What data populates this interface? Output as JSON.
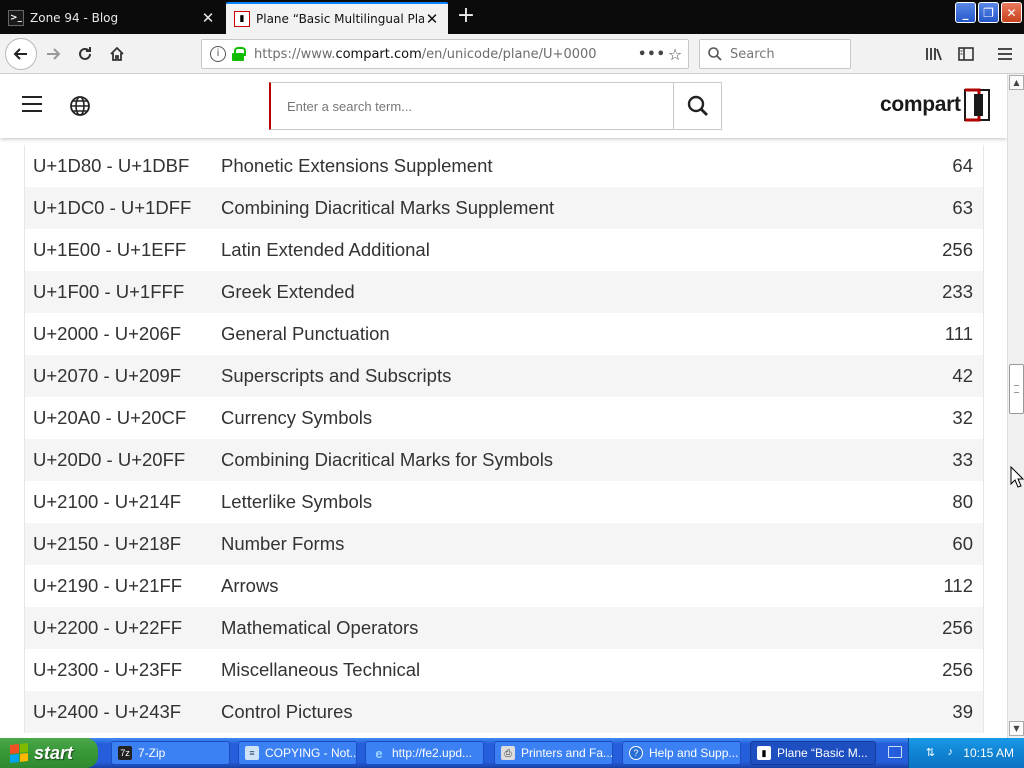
{
  "browser": {
    "tabs": [
      {
        "title": "Zone 94 - Blog",
        "favicon": "terminal-icon"
      },
      {
        "title": "Plane “Basic Multilingual Plane”",
        "favicon": "compart-icon"
      }
    ],
    "url_prefix": "https://www.",
    "url_domain": "compart.com",
    "url_path": "/en/unicode/plane/U+0000",
    "search_placeholder": "Search"
  },
  "site": {
    "search_placeholder": "Enter a search term...",
    "logo_text": "compart",
    "brand_color": "#b00000"
  },
  "blocks": [
    {
      "range": "U+1D80 - U+1DBF",
      "name": "Phonetic Extensions Supplement",
      "count": "64"
    },
    {
      "range": "U+1DC0 - U+1DFF",
      "name": "Combining Diacritical Marks Supplement",
      "count": "63"
    },
    {
      "range": "U+1E00 - U+1EFF",
      "name": "Latin Extended Additional",
      "count": "256"
    },
    {
      "range": "U+1F00 - U+1FFF",
      "name": "Greek Extended",
      "count": "233"
    },
    {
      "range": "U+2000 - U+206F",
      "name": "General Punctuation",
      "count": "111"
    },
    {
      "range": "U+2070 - U+209F",
      "name": "Superscripts and Subscripts",
      "count": "42"
    },
    {
      "range": "U+20A0 - U+20CF",
      "name": "Currency Symbols",
      "count": "32"
    },
    {
      "range": "U+20D0 - U+20FF",
      "name": "Combining Diacritical Marks for Symbols",
      "count": "33"
    },
    {
      "range": "U+2100 - U+214F",
      "name": "Letterlike Symbols",
      "count": "80"
    },
    {
      "range": "U+2150 - U+218F",
      "name": "Number Forms",
      "count": "60"
    },
    {
      "range": "U+2190 - U+21FF",
      "name": "Arrows",
      "count": "112"
    },
    {
      "range": "U+2200 - U+22FF",
      "name": "Mathematical Operators",
      "count": "256"
    },
    {
      "range": "U+2300 - U+23FF",
      "name": "Miscellaneous Technical",
      "count": "256"
    },
    {
      "range": "U+2400 - U+243F",
      "name": "Control Pictures",
      "count": "39"
    }
  ],
  "taskbar": {
    "start_label": "start",
    "tasks": [
      {
        "label": "7-Zip",
        "icon": "archive-icon"
      },
      {
        "label": "COPYING - Not...",
        "icon": "notepad-icon"
      },
      {
        "label": "http://fe2.upd...",
        "icon": "ie-icon"
      },
      {
        "label": "Printers and Fa...",
        "icon": "printer-icon"
      },
      {
        "label": "Help and Supp...",
        "icon": "help-icon"
      },
      {
        "label": "Plane “Basic M...",
        "icon": "compart-icon"
      }
    ],
    "clock": "10:15 AM"
  }
}
